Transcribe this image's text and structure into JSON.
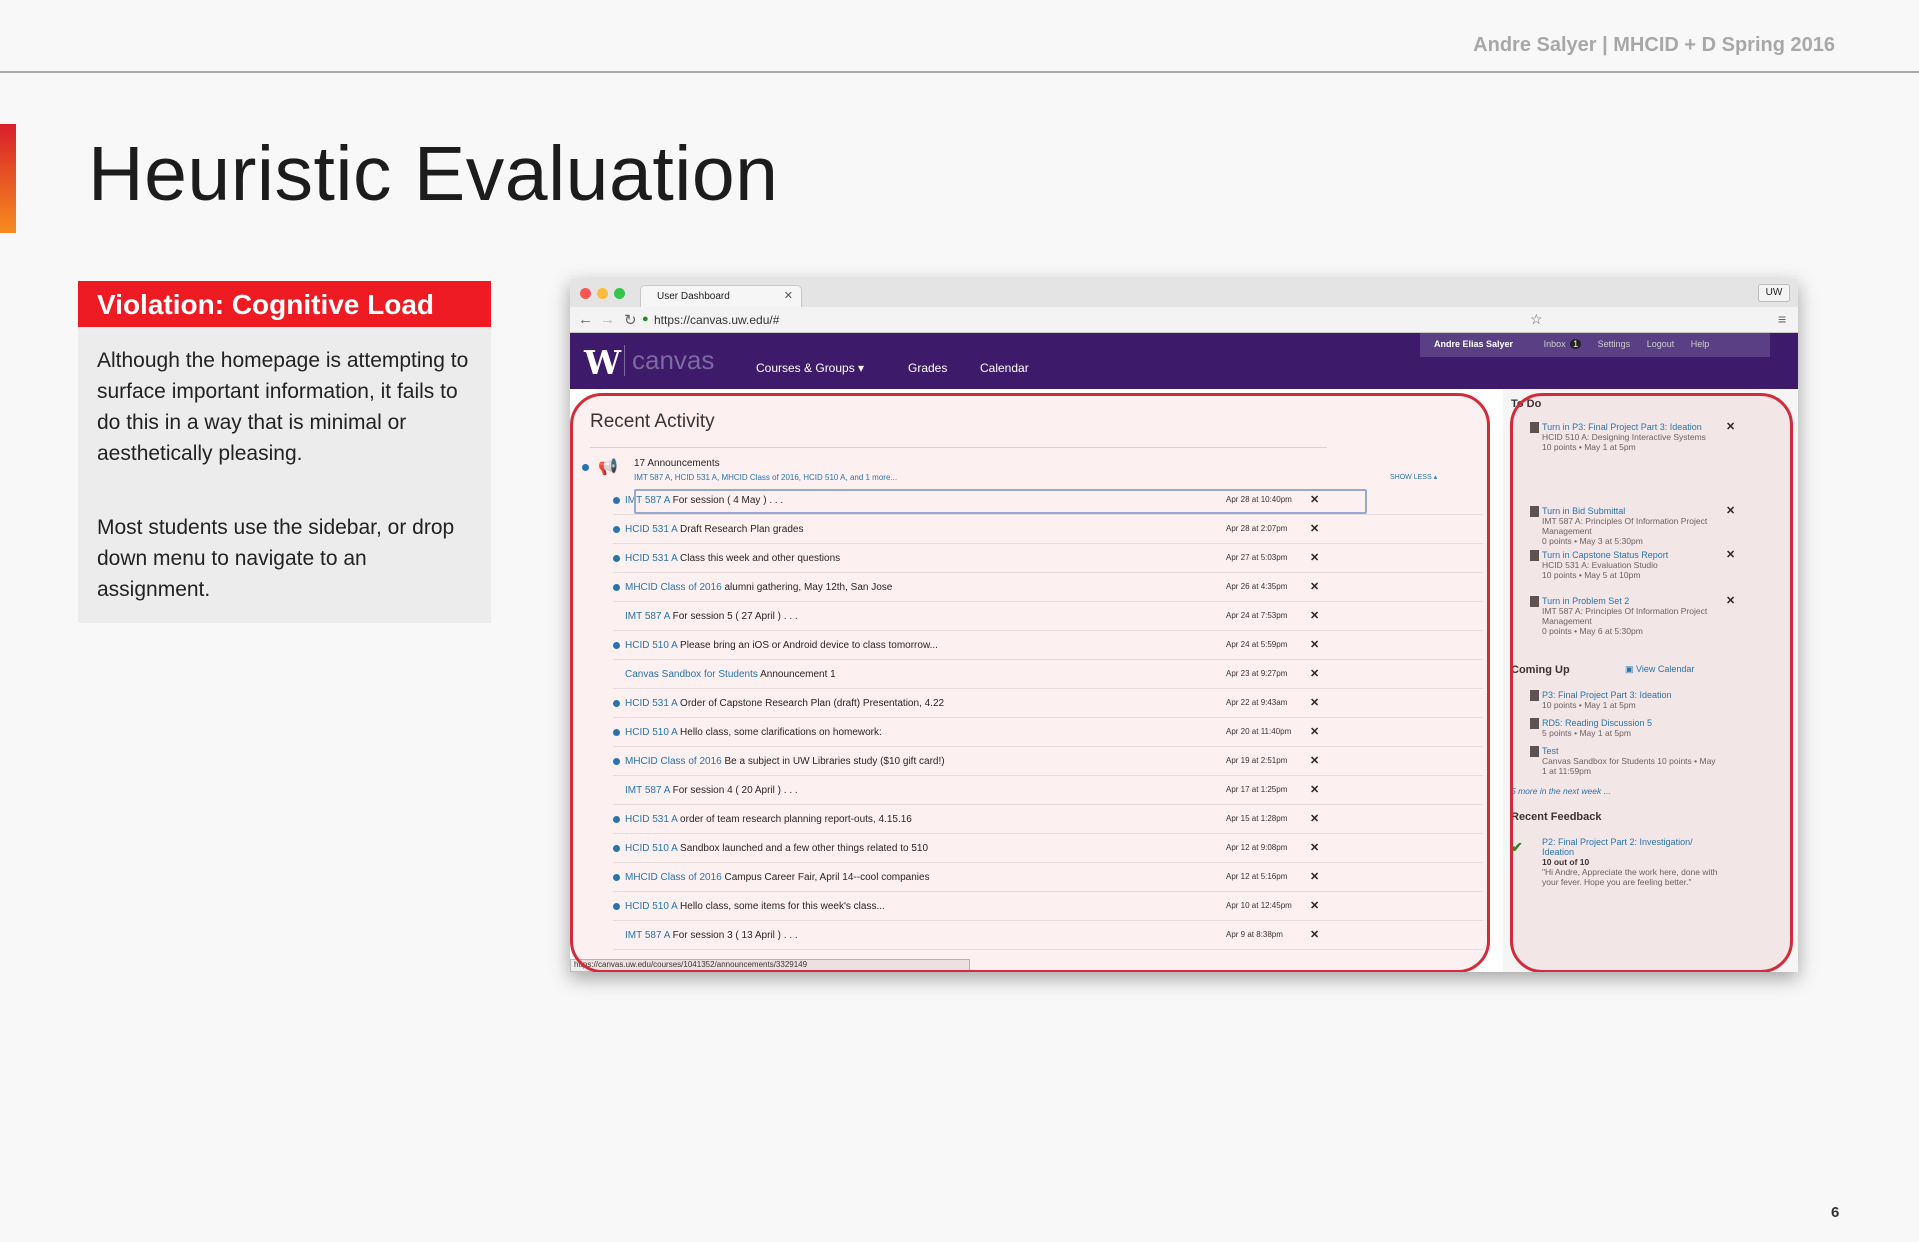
{
  "header": {
    "author": "Andre Salyer | MHCID + D Spring 2016"
  },
  "slide": {
    "title": "Heuristic Evaluation",
    "page_number": "6"
  },
  "violation": {
    "heading": "Violation: Cognitive Load",
    "p1": "Although the homepage is attempting to surface important information, it fails to do this in a way that is minimal or aesthetically pleasing.",
    "p2": "Most students use the sidebar, or drop down menu to navigate to an assignment."
  },
  "browser": {
    "tab_title": "User Dashboard",
    "url": "https://canvas.uw.edu/#",
    "profile": "UW",
    "status_url": "https://canvas.uw.edu/courses/1041352/announcements/3329149"
  },
  "canvas": {
    "logo_w": "W",
    "logo_text": "canvas",
    "menu": [
      "Courses & Groups ▾",
      "Grades",
      "Calendar"
    ],
    "user_menu": [
      "Andre Elias Salyer",
      "Inbox",
      "Settings",
      "Logout",
      "Help"
    ],
    "inbox_count": "1"
  },
  "recent": {
    "title": "Recent Activity",
    "announcements": "17 Announcements",
    "courses": "IMT 587 A, HCID 531 A, MHCID Class of 2016, HCID 510 A, and 1 more...",
    "show_less": "SHOW LESS ▴",
    "rows": [
      {
        "course": "IMT 587 A",
        "text": "For session ( 4 May ) . . .",
        "date": "Apr 28 at 10:40pm"
      },
      {
        "course": "HCID 531 A",
        "text": "Draft Research Plan grades",
        "date": "Apr 28 at 2:07pm"
      },
      {
        "course": "HCID 531 A",
        "text": "Class this week and other questions",
        "date": "Apr 27 at 5:03pm"
      },
      {
        "course": "MHCID Class of 2016",
        "text": "alumni gathering, May 12th, San Jose",
        "date": "Apr 26 at 4:35pm"
      },
      {
        "course": "IMT 587 A",
        "text": "For session 5 ( 27 April ) . . .",
        "date": "Apr 24 at 7:53pm"
      },
      {
        "course": "HCID 510 A",
        "text": "Please bring an iOS or Android device to class tomorrow...",
        "date": "Apr 24 at 5:59pm"
      },
      {
        "course": "Canvas Sandbox for Students",
        "text": "Announcement 1",
        "date": "Apr 23 at 9:27pm"
      },
      {
        "course": "HCID 531 A",
        "text": "Order of Capstone Research Plan (draft) Presentation, 4.22",
        "date": "Apr 22 at 9:43am"
      },
      {
        "course": "HCID 510 A",
        "text": "Hello class, some clarifications on homework:",
        "date": "Apr 20 at 11:40pm"
      },
      {
        "course": "MHCID Class of 2016",
        "text": "Be a subject in UW Libraries study ($10 gift card!)",
        "date": "Apr 19 at 2:51pm"
      },
      {
        "course": "IMT 587 A",
        "text": "For session 4 ( 20 April ) . . .",
        "date": "Apr 17 at 1:25pm"
      },
      {
        "course": "HCID 531 A",
        "text": "order of team research planning report-outs, 4.15.16",
        "date": "Apr 15 at 1:28pm"
      },
      {
        "course": "HCID 510 A",
        "text": "Sandbox launched and a few other things related to 510",
        "date": "Apr 12 at 9:08pm"
      },
      {
        "course": "MHCID Class of 2016",
        "text": "Campus Career Fair, April 14--cool companies",
        "date": "Apr 12 at 5:16pm"
      },
      {
        "course": "HCID 510 A",
        "text": "Hello class, some items for this week's class...",
        "date": "Apr 10 at 12:45pm"
      },
      {
        "course": "IMT 587 A",
        "text": "For session 3 ( 13 April ) . . .",
        "date": "Apr 9 at 8:38pm"
      }
    ]
  },
  "sidebar": {
    "todo_title": "To Do",
    "todo": [
      {
        "link": "Turn in P3: Final Project Part 3: Ideation",
        "course": "HCID 510 A: Designing Interactive Systems",
        "meta": "10 points • May 1 at 5pm"
      },
      {
        "link": "Turn in Bid Submittal",
        "course": "IMT 587 A: Principles Of Information Project Management",
        "meta": "0 points • May 3 at 5:30pm"
      },
      {
        "link": "Turn in Capstone Status Report",
        "course": "HCID 531 A: Evaluation Studio",
        "meta": "10 points • May 5 at 10pm"
      },
      {
        "link": "Turn in Problem Set 2",
        "course": "IMT 587 A: Principles Of Information Project Management",
        "meta": "0 points • May 6 at 5:30pm"
      }
    ],
    "coming_title": "Coming Up",
    "view_calendar": "View Calendar",
    "coming": [
      {
        "link": "P3: Final Project Part 3: Ideation",
        "meta": "10 points • May 1 at 5pm"
      },
      {
        "link": "RD5: Reading Discussion 5",
        "meta": "5 points • May 1 at 5pm"
      },
      {
        "link": "Test",
        "meta": "Canvas Sandbox for Students 10 points • May 1 at 11:59pm"
      }
    ],
    "more": "5 more in the next week ...",
    "feedback_title": "Recent Feedback",
    "feedback": {
      "link": "P2: Final Project Part 2: Investigation/ Ideation",
      "score": "10 out of 10",
      "comment": "\"Hi Andre, Appreciate the work here, done with your fever. Hope you are feeling better.\""
    }
  },
  "colors": {
    "accent": "#ef1b22",
    "canvas_nav": "#3e1a6b",
    "link": "#1a7ab8",
    "highlight": "#d42b3a"
  }
}
